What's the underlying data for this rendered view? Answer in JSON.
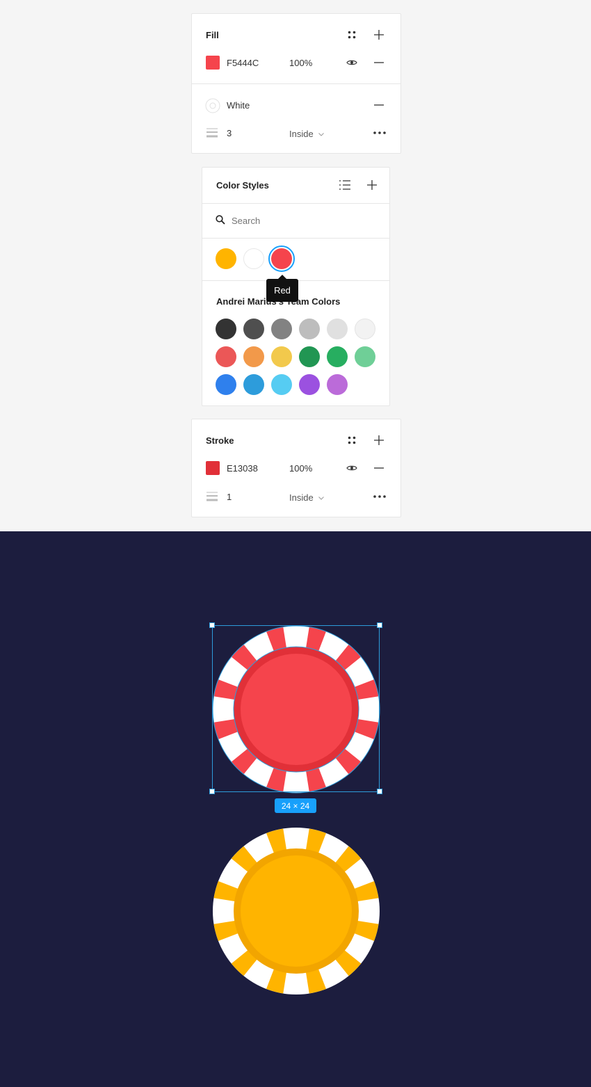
{
  "fill_panel": {
    "title": "Fill",
    "fill_row": {
      "hex": "F5444C",
      "opacity": "100%",
      "color": "#F5444C"
    },
    "white_row": {
      "label": "White"
    },
    "stroke_row": {
      "weight": "3",
      "position": "Inside"
    }
  },
  "color_styles": {
    "title": "Color Styles",
    "search_placeholder": "Search",
    "local_swatches": [
      {
        "name": "Yellow",
        "color": "#FFB400"
      },
      {
        "name": "White",
        "color": "#FFFFFF"
      },
      {
        "name": "Red",
        "color": "#F5444C"
      }
    ],
    "tooltip": "Red",
    "team_title": "Andrei Marius's Team Colors",
    "team_swatches": [
      [
        "#333333",
        "#4f4f4f",
        "#828282",
        "#bdbdbd",
        "#e0e0e0",
        "#f2f2f2"
      ],
      [
        "#eb5757",
        "#f2994a",
        "#f2c94c",
        "#219653",
        "#27ae60",
        "#6fcf97"
      ],
      [
        "#2f80ed",
        "#2d9cdb",
        "#56ccf2",
        "#9b51e0",
        "#bb6bd9"
      ]
    ]
  },
  "stroke_panel": {
    "title": "Stroke",
    "color_row": {
      "hex": "E13038",
      "opacity": "100%",
      "color": "#E13038"
    },
    "weight_row": {
      "weight": "1",
      "position": "Inside"
    }
  },
  "canvas": {
    "background": "#1c1d3e",
    "selection_size": "24 × 24",
    "chips": [
      {
        "name": "red-chip",
        "outer": "#F5444C",
        "ring": "#E13038",
        "inner": "#F5444C"
      },
      {
        "name": "yellow-chip",
        "outer": "#FFB400",
        "ring": "#F2A500",
        "inner": "#FFB400"
      }
    ]
  }
}
